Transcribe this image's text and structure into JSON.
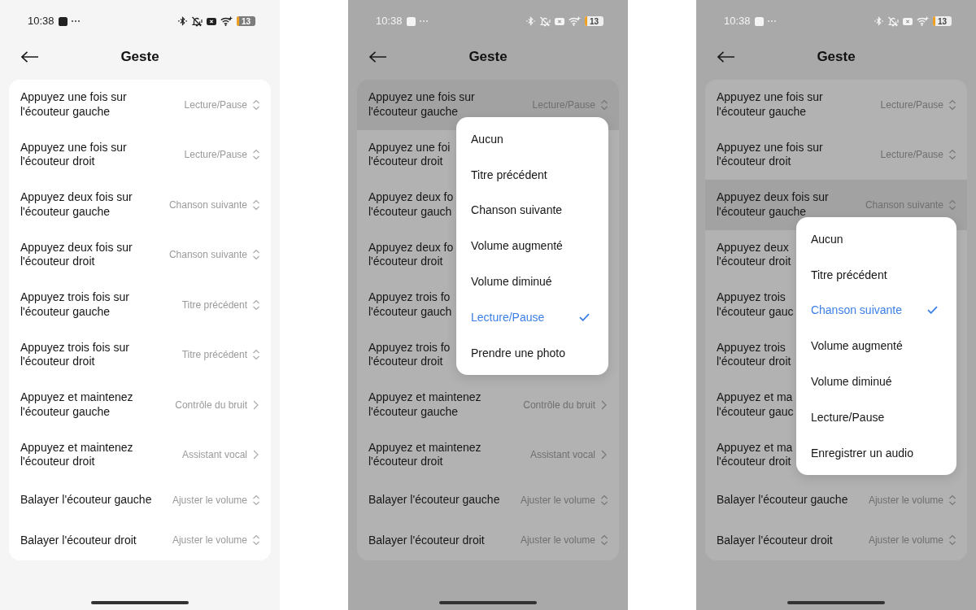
{
  "screens": [
    {
      "dimmed": false,
      "status_bar": {
        "time": "10:38",
        "battery": "13"
      },
      "header": {
        "title": "Geste"
      },
      "rows": [
        {
          "kind": "select",
          "label_lines": [
            "Appuyez une fois sur",
            "l'écouteur gauche"
          ],
          "value": "Lecture/Pause",
          "highlighted": false
        },
        {
          "kind": "select",
          "label_lines": [
            "Appuyez une fois sur",
            "l'écouteur droit"
          ],
          "value": "Lecture/Pause",
          "highlighted": false
        },
        {
          "kind": "select",
          "label_lines": [
            "Appuyez deux fois sur",
            "l'écouteur gauche"
          ],
          "value": "Chanson suivante",
          "highlighted": false
        },
        {
          "kind": "select",
          "label_lines": [
            "Appuyez deux fois sur",
            "l'écouteur droit"
          ],
          "value": "Chanson suivante",
          "highlighted": false
        },
        {
          "kind": "select",
          "label_lines": [
            "Appuyez trois fois sur",
            "l'écouteur gauche"
          ],
          "value": "Titre précédent",
          "highlighted": false
        },
        {
          "kind": "select",
          "label_lines": [
            "Appuyez trois fois sur",
            "l'écouteur droit"
          ],
          "value": "Titre précédent",
          "highlighted": false
        },
        {
          "kind": "link",
          "label_lines": [
            "Appuyez et maintenez",
            "l'écouteur gauche"
          ],
          "value": "Contrôle du bruit",
          "highlighted": false
        },
        {
          "kind": "link",
          "label_lines": [
            "Appuyez et maintenez",
            "l'écouteur droit"
          ],
          "value": "Assistant vocal",
          "highlighted": false
        },
        {
          "kind": "select",
          "label_lines": [
            "Balayer l'écouteur gauche"
          ],
          "value": "Ajuster le volume",
          "highlighted": false
        },
        {
          "kind": "select",
          "label_lines": [
            "Balayer l'écouteur droit"
          ],
          "value": "Ajuster le volume",
          "highlighted": false
        }
      ]
    },
    {
      "dimmed": true,
      "status_bar": {
        "time": "10:38",
        "battery": "13"
      },
      "header": {
        "title": "Geste"
      },
      "rows": [
        {
          "kind": "select",
          "label_lines": [
            "Appuyez une fois sur",
            "l'écouteur gauche"
          ],
          "value": "Lecture/Pause",
          "highlighted": true,
          "menu": {
            "options": [
              {
                "label": "Aucun",
                "selected": false
              },
              {
                "label": "Titre précédent",
                "selected": false
              },
              {
                "label": "Chanson suivante",
                "selected": false
              },
              {
                "label": "Volume augmenté",
                "selected": false
              },
              {
                "label": "Volume diminué",
                "selected": false
              },
              {
                "label": "Lecture/Pause",
                "selected": true
              },
              {
                "label": "Prendre une photo",
                "selected": false
              }
            ]
          }
        },
        {
          "label_lines": [
            "Appuyez une foi",
            "l'écouteur droit"
          ],
          "highlighted": false
        },
        {
          "label_lines": [
            "Appuyez deux fo",
            "l'écouteur gauch"
          ],
          "highlighted": false
        },
        {
          "label_lines": [
            "Appuyez deux fo",
            "l'écouteur droit"
          ],
          "highlighted": false
        },
        {
          "label_lines": [
            "Appuyez trois fo",
            "l'écouteur gauch"
          ],
          "highlighted": false
        },
        {
          "label_lines": [
            "Appuyez trois fo",
            "l'écouteur droit"
          ],
          "highlighted": false
        },
        {
          "kind": "link",
          "label_lines": [
            "Appuyez et maintenez",
            "l'écouteur gauche"
          ],
          "value": "Contrôle du bruit",
          "highlighted": false
        },
        {
          "kind": "link",
          "label_lines": [
            "Appuyez et maintenez",
            "l'écouteur droit"
          ],
          "value": "Assistant vocal",
          "highlighted": false
        },
        {
          "kind": "select",
          "label_lines": [
            "Balayer l'écouteur gauche"
          ],
          "value": "Ajuster le volume",
          "highlighted": false
        },
        {
          "kind": "select",
          "label_lines": [
            "Balayer l'écouteur droit"
          ],
          "value": "Ajuster le volume",
          "highlighted": false
        }
      ]
    },
    {
      "dimmed": true,
      "status_bar": {
        "time": "10:38",
        "battery": "13"
      },
      "header": {
        "title": "Geste"
      },
      "rows": [
        {
          "kind": "select",
          "label_lines": [
            "Appuyez une fois sur",
            "l'écouteur gauche"
          ],
          "value": "Lecture/Pause",
          "highlighted": false
        },
        {
          "kind": "select",
          "label_lines": [
            "Appuyez une fois sur",
            "l'écouteur droit"
          ],
          "value": "Lecture/Pause",
          "highlighted": false
        },
        {
          "kind": "select",
          "label_lines": [
            "Appuyez deux fois sur",
            "l'écouteur gauche"
          ],
          "value": "Chanson suivante",
          "highlighted": true,
          "menu": {
            "options": [
              {
                "label": "Aucun",
                "selected": false
              },
              {
                "label": "Titre précédent",
                "selected": false
              },
              {
                "label": "Chanson suivante",
                "selected": true
              },
              {
                "label": "Volume augmenté",
                "selected": false
              },
              {
                "label": "Volume diminué",
                "selected": false
              },
              {
                "label": "Lecture/Pause",
                "selected": false
              },
              {
                "label": "Enregistrer un audio",
                "selected": false
              }
            ]
          }
        },
        {
          "label_lines": [
            "Appuyez deux",
            "l'écouteur droit"
          ],
          "highlighted": false
        },
        {
          "label_lines": [
            "Appuyez trois",
            "l'écouteur gauc"
          ],
          "highlighted": false
        },
        {
          "label_lines": [
            "Appuyez trois",
            "l'écouteur droit"
          ],
          "highlighted": false
        },
        {
          "label_lines": [
            "Appuyez et ma",
            "l'écouteur gauc"
          ],
          "highlighted": false
        },
        {
          "label_lines": [
            "Appuyez et ma",
            "l'écouteur droit"
          ],
          "highlighted": false
        },
        {
          "kind": "select",
          "label_lines": [
            "Balayer l'écouteur gauche"
          ],
          "value": "Ajuster le volume",
          "highlighted": false
        },
        {
          "kind": "select",
          "label_lines": [
            "Balayer l'écouteur droit"
          ],
          "value": "Ajuster le volume",
          "highlighted": false
        }
      ]
    }
  ]
}
